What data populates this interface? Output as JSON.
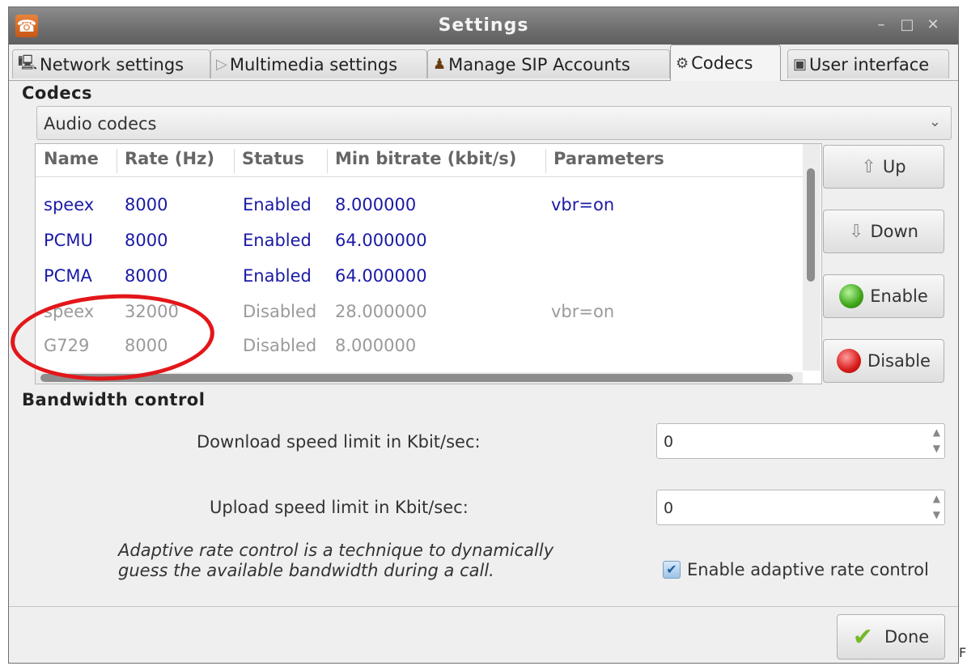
{
  "window": {
    "title": "Settings",
    "minimize_glyph": "–",
    "maximize_glyph": "□",
    "close_glyph": "✕"
  },
  "tabs": [
    {
      "label": "Network settings",
      "icon": "network-icon",
      "active": false
    },
    {
      "label": "Multimedia settings",
      "icon": "play-icon",
      "active": false
    },
    {
      "label": "Manage SIP Accounts",
      "icon": "accounts-icon",
      "active": false
    },
    {
      "label": "Codecs",
      "icon": "codecs-icon",
      "active": true
    },
    {
      "label": "User interface",
      "icon": "user-interface-icon",
      "active": false
    }
  ],
  "codecs": {
    "section_title": "Codecs",
    "selected_type": "Audio codecs",
    "columns": [
      "Name",
      "Rate (Hz)",
      "Status",
      "Min bitrate (kbit/s)",
      "Parameters"
    ],
    "rows": [
      {
        "name": "speex",
        "rate": "8000",
        "status": "Enabled",
        "min_bitrate": "8.000000",
        "parameters": "vbr=on"
      },
      {
        "name": "PCMU",
        "rate": "8000",
        "status": "Enabled",
        "min_bitrate": "64.000000",
        "parameters": ""
      },
      {
        "name": "PCMA",
        "rate": "8000",
        "status": "Enabled",
        "min_bitrate": "64.000000",
        "parameters": ""
      },
      {
        "name": "speex",
        "rate": "32000",
        "status": "Disabled",
        "min_bitrate": "28.000000",
        "parameters": "vbr=on"
      },
      {
        "name": "G729",
        "rate": "8000",
        "status": "Disabled",
        "min_bitrate": "8.000000",
        "parameters": ""
      }
    ],
    "buttons": {
      "up": "Up",
      "down": "Down",
      "enable": "Enable",
      "disable": "Disable"
    }
  },
  "bandwidth": {
    "section_title": "Bandwidth control",
    "download_label": "Download speed limit in Kbit/sec:",
    "download_value": "0",
    "upload_label": "Upload speed limit in Kbit/sec:",
    "upload_value": "0",
    "note": "Adaptive rate control is a technique to dynamically guess the available bandwidth during a call.",
    "adaptive_label": "Enable adaptive rate control",
    "adaptive_checked": true
  },
  "footer": {
    "done_label": "Done"
  },
  "colors": {
    "enabled_text": "#1a1aa6",
    "disabled_text": "#9a9a9a",
    "annotation": "#e3161a"
  },
  "edge_mark": "F"
}
